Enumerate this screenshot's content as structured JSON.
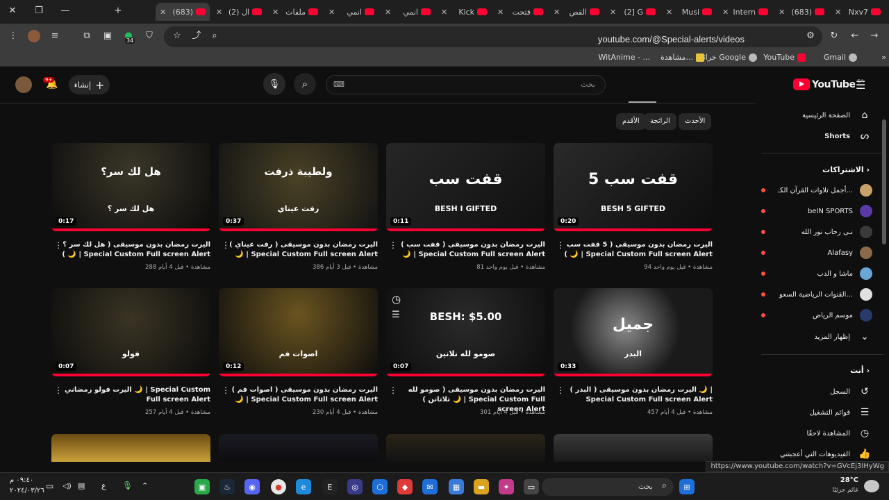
{
  "browser": {
    "tabs": [
      "Nxv7",
      "(683)",
      "Intern",
      "Musi",
      "(2] G",
      "القص",
      "فتحت",
      "Kick",
      "انمي",
      "انمي",
      "ملفات",
      "(2) ال",
      "(683)"
    ],
    "url": "youtube.com/@Special-alerts/videos",
    "extension_badge": "34",
    "bookmarks": [
      "Gmail",
      "YouTube",
      "خرائط Google",
      "مشاهدة...",
      "WitAnime - ..."
    ]
  },
  "youtube": {
    "logo_text": "YouTube",
    "region": "SA",
    "search_placeholder": "بحث",
    "create_label": "إنشاء",
    "notif_badge": "9+",
    "chips": [
      "الأحدث",
      "الرائجة",
      "الأقدم"
    ],
    "sidebar": {
      "home": "الصفحة الرئيسية",
      "shorts": "Shorts",
      "subs_header": "الاشتراكات",
      "subs": [
        {
          "name": "أجمل تلاوات القرآن الكـ...",
          "color": "#c9a26a",
          "live": true
        },
        {
          "name": "beIN SPORTS",
          "color": "#5b3aa6",
          "live": true
        },
        {
          "name": "نـى رحاب نور الله",
          "color": "#3a3a3a",
          "live": true
        },
        {
          "name": "Alafasy",
          "color": "#8a6a4a",
          "live": true
        },
        {
          "name": "ماشا و الدب",
          "color": "#6aa6d6",
          "live": true
        },
        {
          "name": "القنوات الرياضية السعو...",
          "color": "#e0e0e0",
          "live": true
        },
        {
          "name": "موسم الرياض",
          "color": "#2a3a6a",
          "live": true
        }
      ],
      "show_more": "إظهار المزيد",
      "you_header": "أنت",
      "you_items": [
        "السجل",
        "قوائم التشغيل",
        "المشاهدة لاحقًا",
        "الفيديوهات التي أعجبتني"
      ]
    },
    "videos": [
      {
        "title": "اليرت رمضان بدون موسيقى ( 5 قفت سب ) 🌙 | Special Custom Full screen Alert",
        "views": "94 مشاهدة",
        "age": "قبل يوم واحد",
        "duration": "0:20",
        "big": "5 قفت سب",
        "sub": "BESH 5 GIFTED"
      },
      {
        "title": "اليرت رمضان بدون موسيقى ( قفت سب ) 🌙 | Special Custom Full screen Alert",
        "views": "81 مشاهدة",
        "age": "قبل يوم واحد",
        "duration": "0:11",
        "big": "قفت سب",
        "sub": "BESH I GIFTED"
      },
      {
        "title": "اليرت رمضان بدون موسيقى ( رفت عيناي ) 🌙 | Special Custom Full screen Alert",
        "views": "386 مشاهدة",
        "age": "قبل 3 أيام",
        "duration": "0:37",
        "big": "ولطيبة ذرفت",
        "sub": "رفت عيناي"
      },
      {
        "title": "اليرت رمضان بدون موسيقى ( هل لك سر ؟ ) 🌙 | Special Custom Full screen Alert",
        "views": "288 مشاهدة",
        "age": "قبل 4 أيام",
        "duration": "0:17",
        "big": "هل لك سر؟",
        "sub": "هل لك سر ؟"
      },
      {
        "title": "اليرت رمضان بدون موسيقى ( البدر ) 🌙 | Special Custom Full screen Alert",
        "views": "457 مشاهدة",
        "age": "قبل 4 أيام",
        "duration": "0:33",
        "big": "جميل",
        "sub": "البدر"
      },
      {
        "title": "اليرت رمضان بدون موسيقى ( صومو لله تلاتاتن ) 🌙 | Special Custom Full screen Alert",
        "views": "301 مشاهدة",
        "age": "قبل 4 أيام",
        "duration": "0:07",
        "big": "BESH: $5.00",
        "sub": "صومو لله نلانين"
      },
      {
        "title": "اليرت رمضان بدون موسيقى ( اصوات فم ) 🌙 | Special Custom Full screen Alert",
        "views": "230 مشاهدة",
        "age": "قبل 4 أيام",
        "duration": "0:12",
        "big": "",
        "sub": "اصوات فم"
      },
      {
        "title": "اليرت فولو رمضاني 🌙 | Special Custom Full screen Alert",
        "views": "257 مشاهدة",
        "age": "قبل 4 أيام",
        "duration": "0:07",
        "big": "",
        "sub": "فولو"
      }
    ],
    "status_url": "https://www.youtube.com/watch?v=GVcEj3IHyWg"
  },
  "taskbar": {
    "weather_temp": "28°C",
    "weather_desc": "غائم جزئيًا",
    "search_placeholder": "بحث",
    "time": "٠٩:٤٠ م",
    "date": "٢٠٢٤/٠٣/٢٦"
  }
}
